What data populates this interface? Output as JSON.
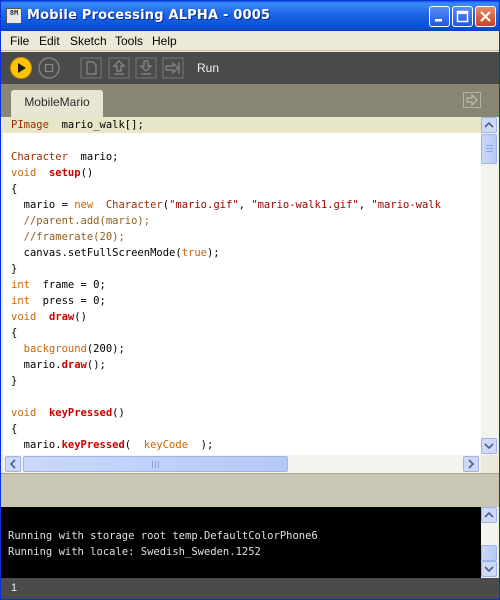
{
  "window": {
    "title": "Mobile Processing ALPHA - 0005",
    "icon_text": "8M"
  },
  "menu": [
    "File",
    "Edit",
    "Sketch",
    "Tools",
    "Help"
  ],
  "toolbar": {
    "run_label": "Run",
    "buttons": [
      "run-icon",
      "stop-icon",
      "new-icon",
      "open-icon",
      "save-icon",
      "export-icon"
    ]
  },
  "tabs": [
    {
      "label": "MobileMario",
      "active": true
    }
  ],
  "editor": {
    "lines": [
      [
        [
          "ty",
          "PImage"
        ],
        [
          "",
          "  mario_walk[];"
        ]
      ],
      [],
      [
        [
          "ty",
          "Character"
        ],
        [
          "",
          "  mario;"
        ]
      ],
      [
        [
          "kw",
          "void"
        ],
        [
          "",
          "  "
        ],
        [
          "fn",
          "setup"
        ],
        [
          "",
          "()"
        ]
      ],
      [
        [
          "",
          "{"
        ]
      ],
      [
        [
          "",
          "  mario = "
        ],
        [
          "kw",
          "new"
        ],
        [
          "",
          "  "
        ],
        [
          "ty",
          "Character"
        ],
        [
          "",
          "("
        ],
        [
          "str",
          "\"mario.gif\""
        ],
        [
          "",
          ", "
        ],
        [
          "str",
          "\"mario-walk1.gif\""
        ],
        [
          "",
          ", "
        ],
        [
          "str",
          "\"mario-walk"
        ]
      ],
      [
        [
          "cm",
          "  //parent.add(mario);"
        ]
      ],
      [
        [
          "cm",
          "  //framerate(20);"
        ]
      ],
      [
        [
          "",
          "  canvas.setFullScreenMode("
        ],
        [
          "lit",
          "true"
        ],
        [
          "",
          ");"
        ]
      ],
      [
        [
          "",
          "}"
        ]
      ],
      [
        [
          "kw",
          "int"
        ],
        [
          "",
          "  frame = 0;"
        ]
      ],
      [
        [
          "kw",
          "int"
        ],
        [
          "",
          "  press = 0;"
        ]
      ],
      [
        [
          "kw",
          "void"
        ],
        [
          "",
          "  "
        ],
        [
          "fn",
          "draw"
        ],
        [
          "",
          "()"
        ]
      ],
      [
        [
          "",
          "{"
        ]
      ],
      [
        [
          "call",
          "  background"
        ],
        [
          "",
          "(200);"
        ]
      ],
      [
        [
          "",
          "  mario."
        ],
        [
          "fn",
          "draw"
        ],
        [
          "",
          "();"
        ]
      ],
      [
        [
          "",
          "}"
        ]
      ],
      [],
      [
        [
          "kw",
          "void"
        ],
        [
          "",
          "  "
        ],
        [
          "fn",
          "keyPressed"
        ],
        [
          "",
          "()"
        ]
      ],
      [
        [
          "",
          "{"
        ]
      ],
      [
        [
          "",
          "  mario."
        ],
        [
          "fn",
          "keyPressed"
        ],
        [
          "",
          "(  "
        ],
        [
          "lit",
          "keyCode"
        ],
        [
          "",
          "  );"
        ]
      ]
    ]
  },
  "console": {
    "lines": [
      "Running with storage root temp.DefaultColorPhone6",
      "Running with locale: Swedish_Sweden.1252"
    ]
  },
  "status": {
    "line_number": "1"
  }
}
